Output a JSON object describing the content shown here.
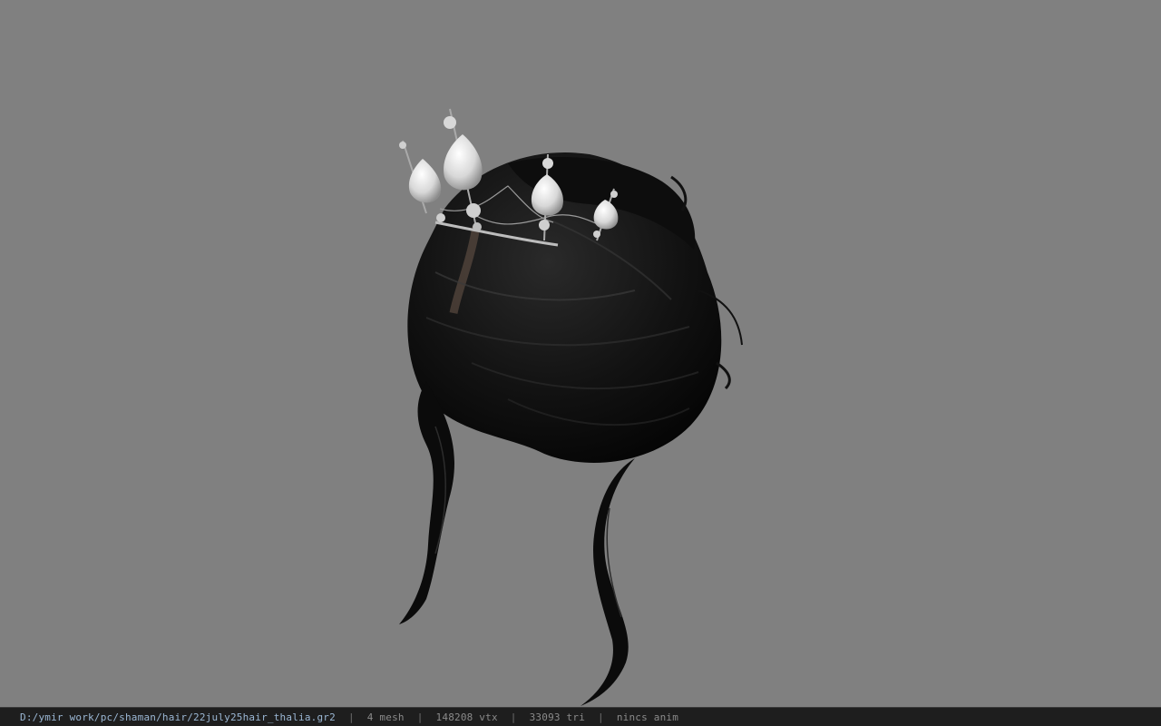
{
  "viewport": {
    "background": "#808080",
    "model_name": "hair-model-with-tiara"
  },
  "statusbar": {
    "file_path": "D:/ymir work/pc/shaman/hair/22july25hair_thalia.gr2",
    "separator": "|",
    "mesh_count": "4 mesh",
    "vertex_count": "148208 vtx",
    "triangle_count": "33093 tri",
    "animation": "nincs anim"
  }
}
